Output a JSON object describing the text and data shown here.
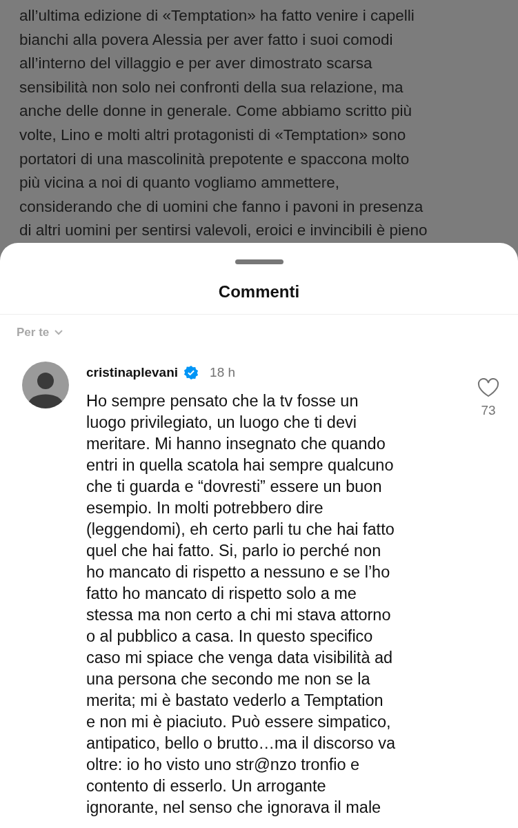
{
  "article": {
    "lines": [
      "all’ultima edizione di «Temptation» ha fatto venire i capelli",
      "bianchi alla povera Alessia per aver fatto i suoi comodi",
      "all’interno del villaggio e per aver dimostrato scarsa",
      "sensibilità non solo nei confronti della sua relazione, ma",
      "anche delle donne in generale. Come abbiamo scritto più",
      "volte, Lino e molti altri protagonisti di «Temptation» sono",
      "portatori di una mascolinità prepotente e spaccona molto",
      "più vicina a noi di quanto vogliamo ammettere,",
      "considerando che di uomini che fanno i pavoni in presenza",
      "di altri uomini per sentirsi valevoli, eroici e invincibili è pieno"
    ]
  },
  "sheet": {
    "title": "Commenti",
    "sort": "Per te"
  },
  "comment": {
    "username": "cristinaplevani",
    "verified": true,
    "time": "18 h",
    "liked": false,
    "likes": "73",
    "lines": [
      "Ho sempre pensato che la tv fosse un",
      "luogo privilegiato, un luogo che ti devi",
      "meritare. Mi hanno insegnato che quando",
      "entri in quella scatola hai sempre qualcuno",
      "che ti guarda e “dovresti” essere un buon",
      "esempio. In molti potrebbero dire",
      "(leggendomi), eh certo parli tu che hai fatto",
      "quel che hai fatto. Si, parlo io perché non",
      "ho mancato di rispetto a nessuno e se l’ho",
      "fatto ho mancato di rispetto solo a me",
      "stessa ma non certo a chi mi stava attorno",
      "o al pubblico a casa. In questo specifico",
      "caso mi spiace che venga data visibilità ad",
      "una persona che secondo me non se la",
      "merita; mi è bastato vederlo a Temptation",
      "e non mi è piaciuto. Può essere simpatico,",
      "antipatico, bello o brutto…ma il discorso va",
      "oltre: io ho visto uno str@nzo tronfio e",
      "contento di esserlo. Un arrogante",
      "ignorante, nel senso che ignorava il male"
    ]
  }
}
